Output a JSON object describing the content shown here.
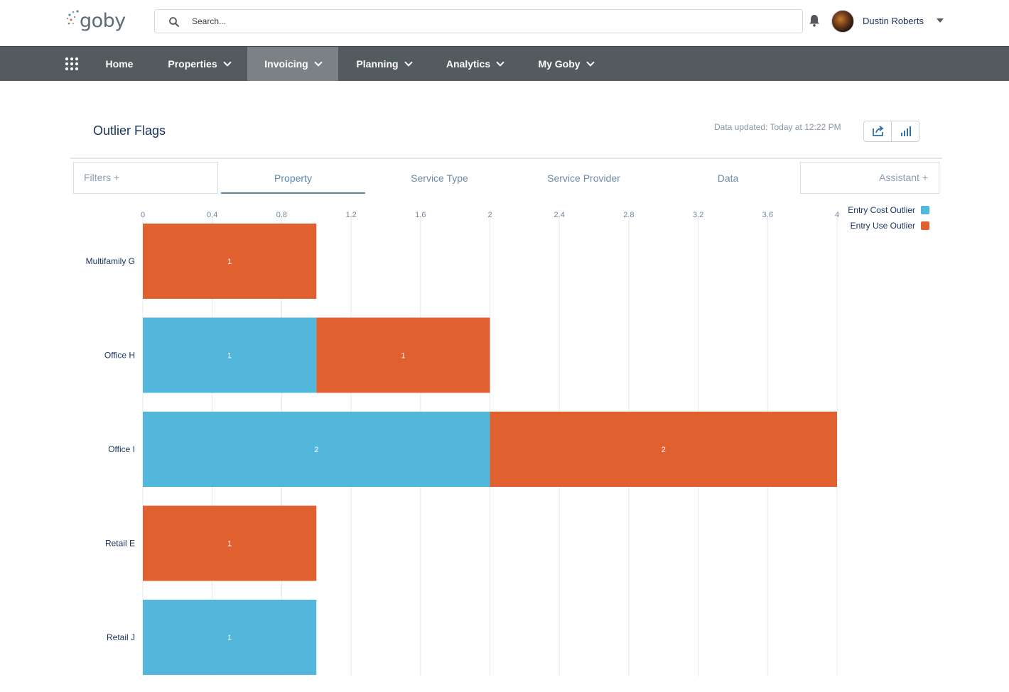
{
  "header": {
    "logo_text": "goby",
    "search_placeholder": "Search...",
    "user_name": "Dustin Roberts"
  },
  "nav": {
    "items": [
      {
        "label": "Home",
        "has_menu": false
      },
      {
        "label": "Properties",
        "has_menu": true
      },
      {
        "label": "Invoicing",
        "has_menu": true,
        "active": true
      },
      {
        "label": "Planning",
        "has_menu": true
      },
      {
        "label": "Analytics",
        "has_menu": true
      },
      {
        "label": "My Goby",
        "has_menu": true
      }
    ]
  },
  "page": {
    "title": "Outlier Flags",
    "updated": "Data updated: Today at 12:22 PM"
  },
  "tabs": {
    "filters": "Filters +",
    "assistant": "Assistant +",
    "items": [
      "Property",
      "Service Type",
      "Service Provider",
      "Data"
    ],
    "active": "Property"
  },
  "colors": {
    "cost": "#52b7db",
    "use": "#e0602f",
    "nav_bg": "#545b5f",
    "nav_active": "#7b8185"
  },
  "chart_data": {
    "type": "bar",
    "orientation": "horizontal",
    "stacked": true,
    "categories": [
      "Multifamily G",
      "Office H",
      "Office I",
      "Retail E",
      "Retail J"
    ],
    "series": [
      {
        "name": "Entry Cost Outlier",
        "values": [
          0,
          1,
          2,
          0,
          1
        ]
      },
      {
        "name": "Entry Use Outlier",
        "values": [
          1,
          1,
          2,
          1,
          0
        ]
      }
    ],
    "xlim": [
      0,
      4
    ],
    "xticks": [
      "0",
      "0.4",
      "0.8",
      "1.2",
      "1.6",
      "2",
      "2.4",
      "2.8",
      "3.2",
      "3.6",
      "4"
    ],
    "xtick_values": [
      0,
      0.4,
      0.8,
      1.2,
      1.6,
      2,
      2.4,
      2.8,
      3.2,
      3.6,
      4
    ],
    "grid": true,
    "legend_position": "top-right"
  }
}
